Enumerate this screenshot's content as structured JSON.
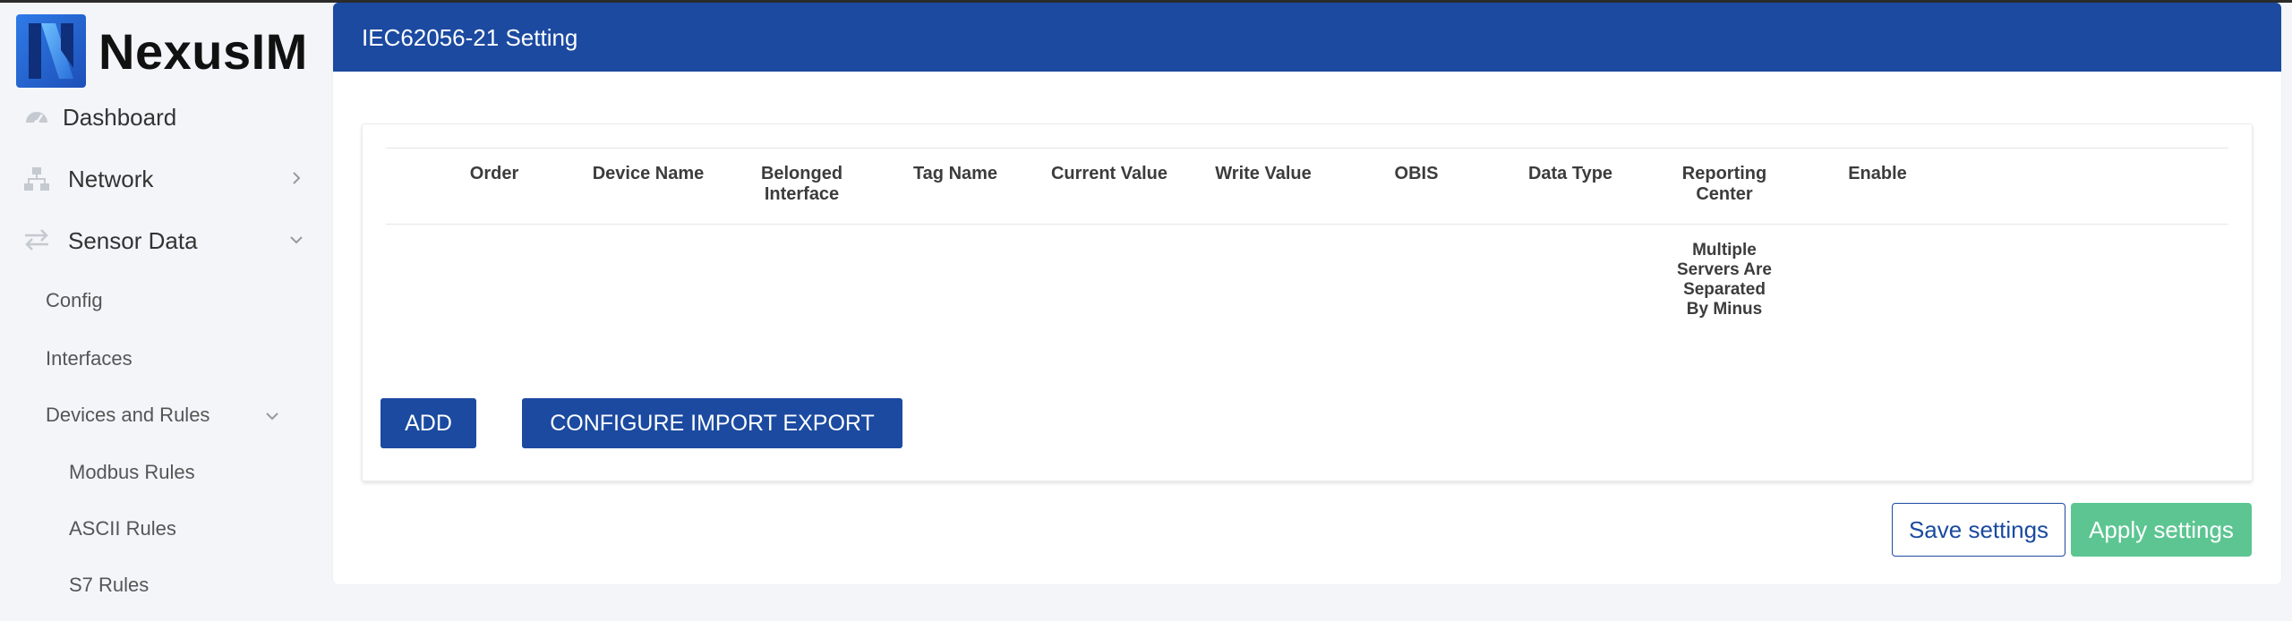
{
  "brand": {
    "name": "NexusIM"
  },
  "sidebar": {
    "items": [
      {
        "label": "Dashboard",
        "icon": "gauge-icon"
      },
      {
        "label": "Network",
        "icon": "network-icon"
      },
      {
        "label": "Sensor Data",
        "icon": "swap-arrows-icon"
      },
      {
        "label": "Config"
      },
      {
        "label": "Interfaces"
      },
      {
        "label": "Devices and Rules"
      },
      {
        "label": "Modbus Rules"
      },
      {
        "label": "ASCII Rules"
      },
      {
        "label": "S7 Rules"
      }
    ]
  },
  "page": {
    "title": "IEC62056-21 Setting"
  },
  "table": {
    "columns": [
      "Order",
      "Device Name",
      "Belonged Interface",
      "Tag Name",
      "Current Value",
      "Write Value",
      "OBIS",
      "Data Type",
      "Reporting Center",
      "Enable"
    ],
    "reporting_note": "Multiple Servers Are Separated By Minus"
  },
  "actions": {
    "add": "ADD",
    "configure_import_export": "CONFIGURE IMPORT EXPORT",
    "save": "Save settings",
    "apply": "Apply settings"
  },
  "colors": {
    "primary": "#1b4aa0",
    "apply": "#5cc592",
    "background": "#f4f5f9"
  }
}
